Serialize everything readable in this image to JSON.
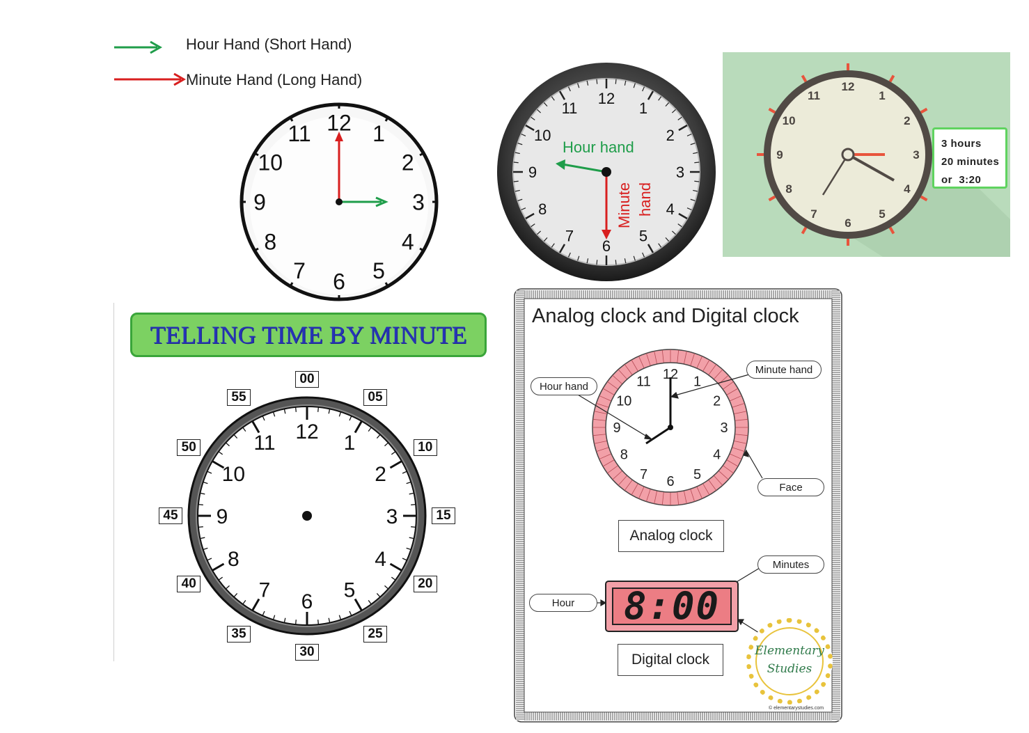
{
  "legend": {
    "hour_label": "Hour Hand (Short Hand)",
    "minute_label": "Minute Hand (Long Hand)",
    "hour_color": "#1f9d4a",
    "minute_color": "#d81f1f"
  },
  "clock1": {
    "numbers": [
      "12",
      "1",
      "2",
      "3",
      "4",
      "5",
      "6",
      "7",
      "8",
      "9",
      "10",
      "11"
    ],
    "time_shown": "3:00"
  },
  "clock2": {
    "numbers": [
      "12",
      "1",
      "2",
      "3",
      "4",
      "5",
      "6",
      "7",
      "8",
      "9",
      "10",
      "11"
    ],
    "hour_label": "Hour hand",
    "minute_label_1": "Minute",
    "minute_label_2": "hand"
  },
  "clock3": {
    "numbers": [
      "12",
      "1",
      "2",
      "3",
      "4",
      "5",
      "6",
      "7",
      "8",
      "9",
      "10",
      "11"
    ],
    "callout_line1": "3 hours",
    "callout_line2": "20 minutes",
    "callout_line3": "or  3:20",
    "accent": "#e8543c",
    "background": "#b9dbbb"
  },
  "minute_clock": {
    "title": "TELLING TIME BY MINUTE",
    "numbers": [
      "12",
      "1",
      "2",
      "3",
      "4",
      "5",
      "6",
      "7",
      "8",
      "9",
      "10",
      "11"
    ],
    "minute_labels": [
      "00",
      "05",
      "10",
      "15",
      "20",
      "25",
      "30",
      "35",
      "40",
      "45",
      "50",
      "55"
    ]
  },
  "sheet": {
    "title": "Analog clock and Digital clock",
    "numbers": [
      "12",
      "1",
      "2",
      "3",
      "4",
      "5",
      "6",
      "7",
      "8",
      "9",
      "10",
      "11"
    ],
    "hour_hand_label": "Hour hand",
    "minute_hand_label": "Minute hand",
    "face_label": "Face",
    "analog_label": "Analog clock",
    "minutes_label": "Minutes",
    "hour_label": "Hour",
    "digital_time": "8:00",
    "digital_label": "Digital clock",
    "logo_line1": "Elementary",
    "logo_line2": "Studies",
    "copyright": "© elementarystudies.com",
    "ring_color": "#f2a0a8"
  }
}
